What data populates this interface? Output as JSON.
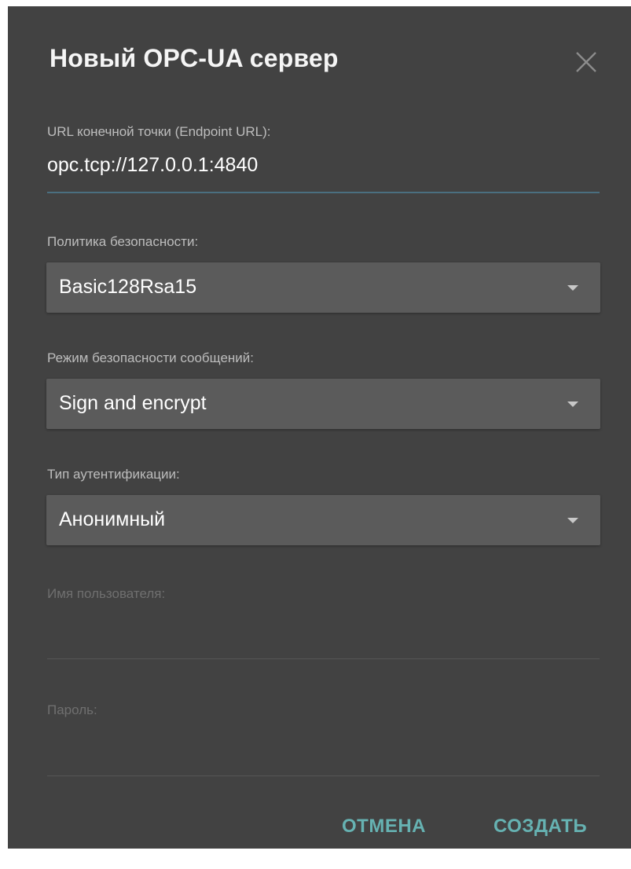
{
  "dialog": {
    "title": "Новый OPC-UA сервер",
    "close_icon": "close-icon"
  },
  "endpoint": {
    "label": "URL конечной точки (Endpoint URL):",
    "value": "opc.tcp://127.0.0.1:4840"
  },
  "security_policy": {
    "label": "Политика безопасности:",
    "selected": "Basic128Rsa15"
  },
  "message_security_mode": {
    "label": "Режим безопасности сообщений:",
    "selected": "Sign and encrypt"
  },
  "auth_type": {
    "label": "Тип аутентификации:",
    "selected": "Анонимный"
  },
  "username": {
    "label": "Имя пользователя:",
    "value": ""
  },
  "password": {
    "label": "Пароль:",
    "value": ""
  },
  "actions": {
    "cancel_label": "ОТМЕНА",
    "create_label": "СОЗДАТЬ"
  },
  "colors": {
    "dialog_bg": "#424242",
    "select_bg": "#5b5b5b",
    "accent": "#66b2b2",
    "active_underline": "#4a6f80"
  }
}
